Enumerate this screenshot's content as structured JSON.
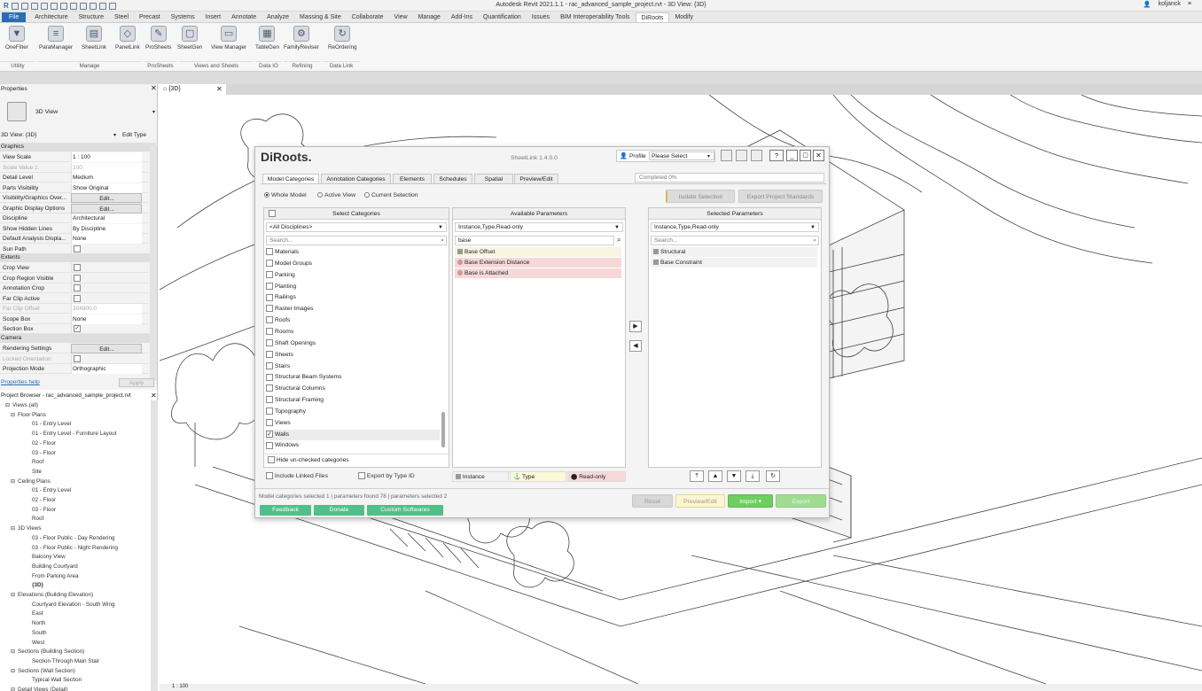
{
  "window": {
    "title": "Autodesk Revit 2021.1.1 - rac_advanced_sample_project.rvt - 3D View: {3D}",
    "user": "koljanck"
  },
  "menubar": {
    "tabs": [
      "File",
      "Architecture",
      "Structure",
      "Steel",
      "Precast",
      "Systems",
      "Insert",
      "Annotate",
      "Analyze",
      "Massing & Site",
      "Collaborate",
      "View",
      "Manage",
      "Add-Ins",
      "Quantification",
      "Issues",
      "BIM Interoperability Tools",
      "DiRoots",
      "Modify"
    ]
  },
  "ribbon": {
    "buttons": [
      {
        "label": "OneFilter",
        "icon": "funnel-icon"
      },
      {
        "label": "ParaManager",
        "icon": "parameters-icon"
      },
      {
        "label": "SheetLink",
        "icon": "sheet-link-icon"
      },
      {
        "label": "PanelLink",
        "icon": "panel-link-icon"
      },
      {
        "label": "ProSheets",
        "icon": "prosheets-icon"
      },
      {
        "label": "SheetGen",
        "icon": "sheetgen-icon"
      },
      {
        "label": "View Manager",
        "icon": "view-manager-icon"
      },
      {
        "label": "TableGen",
        "icon": "table-icon"
      },
      {
        "label": "FamilyReviser",
        "icon": "family-icon"
      },
      {
        "label": "ReOrdering",
        "icon": "reorder-icon"
      }
    ],
    "groups": [
      "Utility",
      "Manage",
      "ProSheets",
      "Views and Sheets",
      "Data IO",
      "Refining",
      "Data Link"
    ]
  },
  "properties": {
    "title": "Properties",
    "type": "3D View",
    "instance": "3D View: {3D}",
    "edit_type": "Edit Type",
    "sections": {
      "graphics": "Graphics",
      "extents": "Extents",
      "camera": "Camera"
    },
    "rows_graphics": [
      {
        "k": "View Scale",
        "v": "1 : 100"
      },
      {
        "k": "Scale Value    1:",
        "v": "100",
        "dim": true
      },
      {
        "k": "Detail Level",
        "v": "Medium"
      },
      {
        "k": "Parts Visibility",
        "v": "Show Original"
      },
      {
        "k": "Visibility/Graphics Over...",
        "v": "Edit...",
        "btn": true
      },
      {
        "k": "Graphic Display Options",
        "v": "Edit...",
        "btn": true
      },
      {
        "k": "Discipline",
        "v": "Architectural"
      },
      {
        "k": "Show Hidden Lines",
        "v": "By Discipline"
      },
      {
        "k": "Default Analysis Displa...",
        "v": "None"
      },
      {
        "k": "Sun Path",
        "v": "",
        "cb": true
      }
    ],
    "rows_extents": [
      {
        "k": "Crop View",
        "v": "",
        "cb": true
      },
      {
        "k": "Crop Region Visible",
        "v": "",
        "cb": true
      },
      {
        "k": "Annotation Crop",
        "v": "",
        "cb": true
      },
      {
        "k": "Far Clip Active",
        "v": "",
        "cb": true
      },
      {
        "k": "Far Clip Offset",
        "v": "304800.0",
        "dim": true
      },
      {
        "k": "Scope Box",
        "v": "None"
      },
      {
        "k": "Section Box",
        "v": "✓",
        "cb": true
      }
    ],
    "rows_camera": [
      {
        "k": "Rendering Settings",
        "v": "Edit...",
        "btn": true
      },
      {
        "k": "Locked Orientation",
        "v": "",
        "cb": true,
        "dim": true
      },
      {
        "k": "Projection Mode",
        "v": "Orthographic"
      }
    ],
    "help": "Properties help",
    "apply": "Apply"
  },
  "browser": {
    "title": "Project Browser - rac_advanced_sample_project.rvt",
    "items": [
      {
        "t": "Views (all)",
        "l": 0
      },
      {
        "t": "Floor Plans",
        "l": 1
      },
      {
        "t": "01 - Entry Level",
        "l": 2
      },
      {
        "t": "01 - Entry Level - Furniture Layout",
        "l": 2
      },
      {
        "t": "02 - Floor",
        "l": 2
      },
      {
        "t": "03 - Floor",
        "l": 2
      },
      {
        "t": "Roof",
        "l": 2
      },
      {
        "t": "Site",
        "l": 2
      },
      {
        "t": "Ceiling Plans",
        "l": 1
      },
      {
        "t": "01 - Entry Level",
        "l": 2
      },
      {
        "t": "02 - Floor",
        "l": 2
      },
      {
        "t": "03 - Floor",
        "l": 2
      },
      {
        "t": "Roof",
        "l": 2
      },
      {
        "t": "3D Views",
        "l": 1
      },
      {
        "t": "03 - Floor Public - Day Rendering",
        "l": 2
      },
      {
        "t": "03 - Floor Public - Night Rendering",
        "l": 2
      },
      {
        "t": "Balcony View",
        "l": 2
      },
      {
        "t": "Building Courtyard",
        "l": 2
      },
      {
        "t": "From Parking Area",
        "l": 2
      },
      {
        "t": "{3D}",
        "l": 2,
        "b": true
      },
      {
        "t": "Elevations (Building Elevation)",
        "l": 1
      },
      {
        "t": "Courtyard Elevation - South Wing",
        "l": 2
      },
      {
        "t": "East",
        "l": 2
      },
      {
        "t": "North",
        "l": 2
      },
      {
        "t": "South",
        "l": 2
      },
      {
        "t": "West",
        "l": 2
      },
      {
        "t": "Sections (Building Section)",
        "l": 1
      },
      {
        "t": "Section Through Main Stair",
        "l": 2
      },
      {
        "t": "Sections (Wall Section)",
        "l": 1
      },
      {
        "t": "Typical Wall Section",
        "l": 2
      },
      {
        "t": "Detail Views (Detail)",
        "l": 1
      }
    ]
  },
  "viewtab": {
    "label": "{3D}"
  },
  "status": {
    "scale": "1 : 100"
  },
  "dialog": {
    "logo": "DiRoots.",
    "title": "SheetLink 1.4.0.0",
    "profile_label": "Profile",
    "profile_value": "Please Select",
    "help_btn": "?",
    "progress": "Completed 0%",
    "tabs": [
      "Model Categories",
      "Annotation Categories",
      "Elements",
      "Schedules",
      "Spatial",
      "Preview/Edit"
    ],
    "scope": [
      "Whole Model",
      "Active View",
      "Current Selection"
    ],
    "isolate": "Isolate Selection",
    "export_std": "Export Project Standards",
    "select_categories": "Select Categories",
    "disciplines": "<All Disciplines>",
    "cat_search": "Search...",
    "categories": [
      {
        "t": "Materials",
        "c": false
      },
      {
        "t": "Model Groups",
        "c": false
      },
      {
        "t": "Parking",
        "c": false
      },
      {
        "t": "Planting",
        "c": false
      },
      {
        "t": "Railings",
        "c": false
      },
      {
        "t": "Raster Images",
        "c": false
      },
      {
        "t": "Roofs",
        "c": false
      },
      {
        "t": "Rooms",
        "c": false
      },
      {
        "t": "Shaft Openings",
        "c": false
      },
      {
        "t": "Sheets",
        "c": false
      },
      {
        "t": "Stairs",
        "c": false
      },
      {
        "t": "Structural Beam Systems",
        "c": false
      },
      {
        "t": "Structural Columns",
        "c": false
      },
      {
        "t": "Structural Framing",
        "c": false
      },
      {
        "t": "Topography",
        "c": false
      },
      {
        "t": "Views",
        "c": false
      },
      {
        "t": "Walls",
        "c": true
      },
      {
        "t": "Windows",
        "c": false
      }
    ],
    "hide_unchecked": "Hide un-checked categories",
    "available_parameters": "Available Parameters",
    "avail_filter": "Instance,Type,Read-only",
    "avail_search": "base",
    "avail_params": [
      {
        "t": "Base Offset",
        "kind": "instance"
      },
      {
        "t": "Base Extension Distance",
        "kind": "readonly"
      },
      {
        "t": "Base is Attached",
        "kind": "readonly"
      }
    ],
    "selected_parameters": "Selected Parameters",
    "sel_filter": "Instance,Type,Read-only",
    "sel_search": "Search...",
    "sel_params": [
      "Structural",
      "Base Constraint"
    ],
    "include_linked": "Include Linked Files",
    "export_by_type": "Export by Type ID",
    "legend": {
      "instance": "Instance",
      "type": "Type",
      "readonly": "Read-only"
    },
    "status": "Model categories selected 1 | parameters found 78 | parameters selected 2",
    "feedback": "Feedback",
    "donate": "Donate",
    "custom": "Custom Softwares",
    "reset": "Reset",
    "preview_edit": "Preview/Edit",
    "import": "Import",
    "export": "Export"
  }
}
